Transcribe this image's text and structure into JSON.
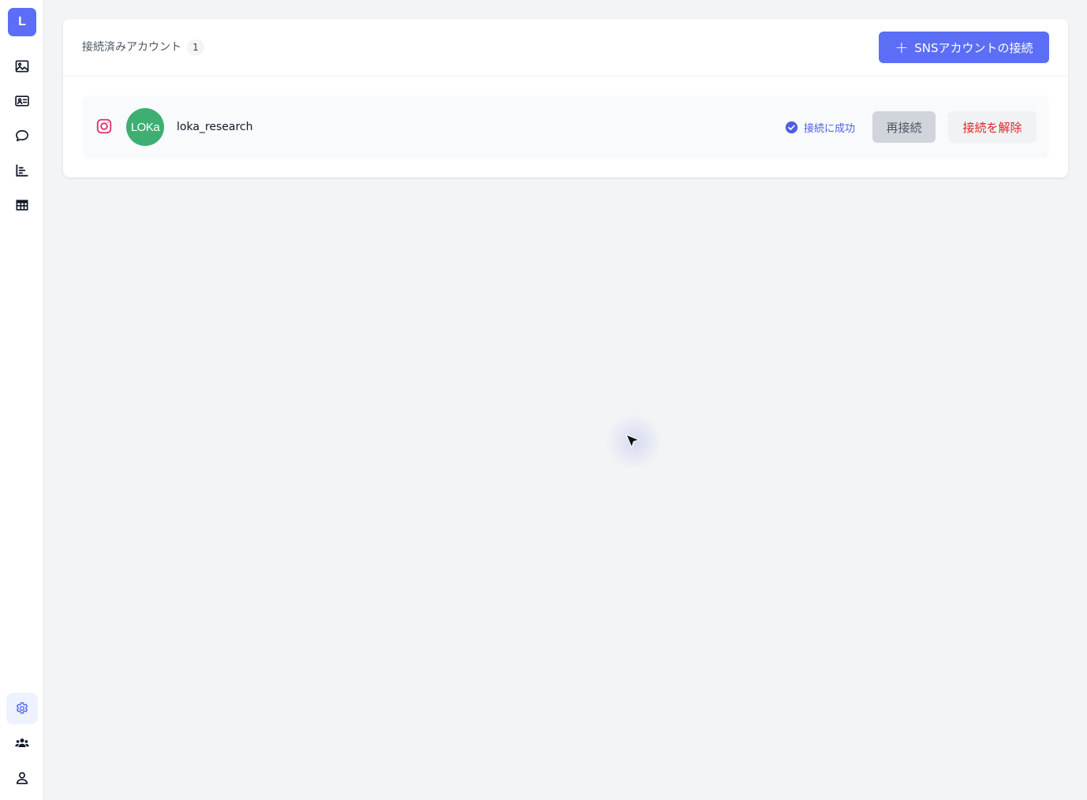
{
  "app": {
    "logo_letter": "L"
  },
  "sidebar": {
    "items": [
      {
        "icon": "image-icon"
      },
      {
        "icon": "id-card-icon"
      },
      {
        "icon": "chat-bubble-icon"
      },
      {
        "icon": "bar-chart-icon"
      },
      {
        "icon": "table-grid-icon"
      }
    ],
    "bottom_items": [
      {
        "icon": "gear-icon",
        "active": true
      },
      {
        "icon": "users-group-icon"
      },
      {
        "icon": "user-icon"
      }
    ]
  },
  "card": {
    "title": "接続済みアカウント",
    "count": "1",
    "connect_button_label": "SNSアカウントの接続"
  },
  "accounts": [
    {
      "platform": "instagram",
      "avatar_text": "LOKa",
      "username": "loka_research",
      "status": "接続に成功",
      "reconnect_label": "再接続",
      "disconnect_label": "接続を解除"
    }
  ],
  "colors": {
    "accent": "#5b6ef5",
    "avatar_bg": "#3fae72",
    "danger": "#dc2626",
    "instagram": "#e1306c"
  }
}
